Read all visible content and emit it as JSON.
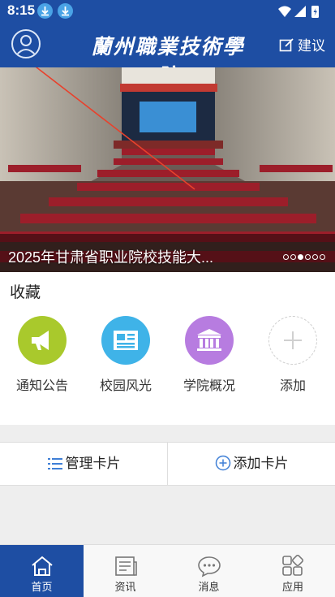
{
  "status_bar": {
    "time": "8:15"
  },
  "header": {
    "title": "蘭州職業技術學院",
    "suggest_label": "建议"
  },
  "banner": {
    "caption": "2025年甘肃省职业院校技能大...",
    "slide_count": 6,
    "active_slide": 3
  },
  "favorites": {
    "title": "收藏",
    "items": [
      {
        "label": "通知公告",
        "icon": "megaphone-icon",
        "color": "#a9c92c"
      },
      {
        "label": "校园风光",
        "icon": "news-icon",
        "color": "#3fb3e8"
      },
      {
        "label": "学院概况",
        "icon": "institution-icon",
        "color": "#b77ce0"
      },
      {
        "label": "添加",
        "icon": "plus-icon",
        "color": "#ffffff"
      }
    ]
  },
  "cards": {
    "manage_label": "管理卡片",
    "add_label": "添加卡片"
  },
  "tabbar": {
    "items": [
      {
        "label": "首页",
        "icon": "home-icon"
      },
      {
        "label": "资讯",
        "icon": "news-icon"
      },
      {
        "label": "消息",
        "icon": "message-icon"
      },
      {
        "label": "应用",
        "icon": "apps-icon"
      }
    ],
    "active": 0
  },
  "colors": {
    "brand": "#1e4ea3",
    "accent_blue": "#3fb3e8"
  }
}
